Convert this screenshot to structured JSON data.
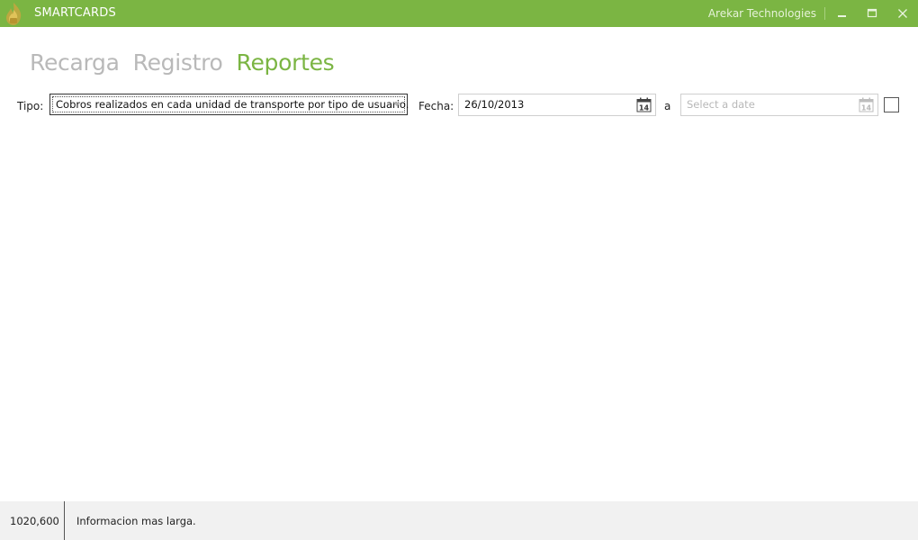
{
  "window": {
    "app_title": "SMARTCARDS",
    "company": "Arekar Technologies",
    "accent_color": "#7bb543",
    "icons": [
      "app-logo-icon",
      "minimize-icon",
      "maximize-icon",
      "close-icon"
    ]
  },
  "nav": {
    "tabs": [
      {
        "label": "Recarga",
        "active": false
      },
      {
        "label": "Registro",
        "active": false
      },
      {
        "label": "Reportes",
        "active": true
      }
    ]
  },
  "filters": {
    "tipo_label": "Tipo:",
    "tipo_selected": "Cobros realizados en cada unidad de transporte por tipo de usuario.",
    "fecha_label": "Fecha:",
    "date_from_value": "26/10/2013",
    "range_separator": "a",
    "date_to_placeholder": "Select a date",
    "date_to_value": "",
    "checkbox_checked": false,
    "calendar_icon": "calendar-icon",
    "calendar_day": "14"
  },
  "status": {
    "size_text": "1020,600",
    "message": "Informacion mas larga."
  }
}
